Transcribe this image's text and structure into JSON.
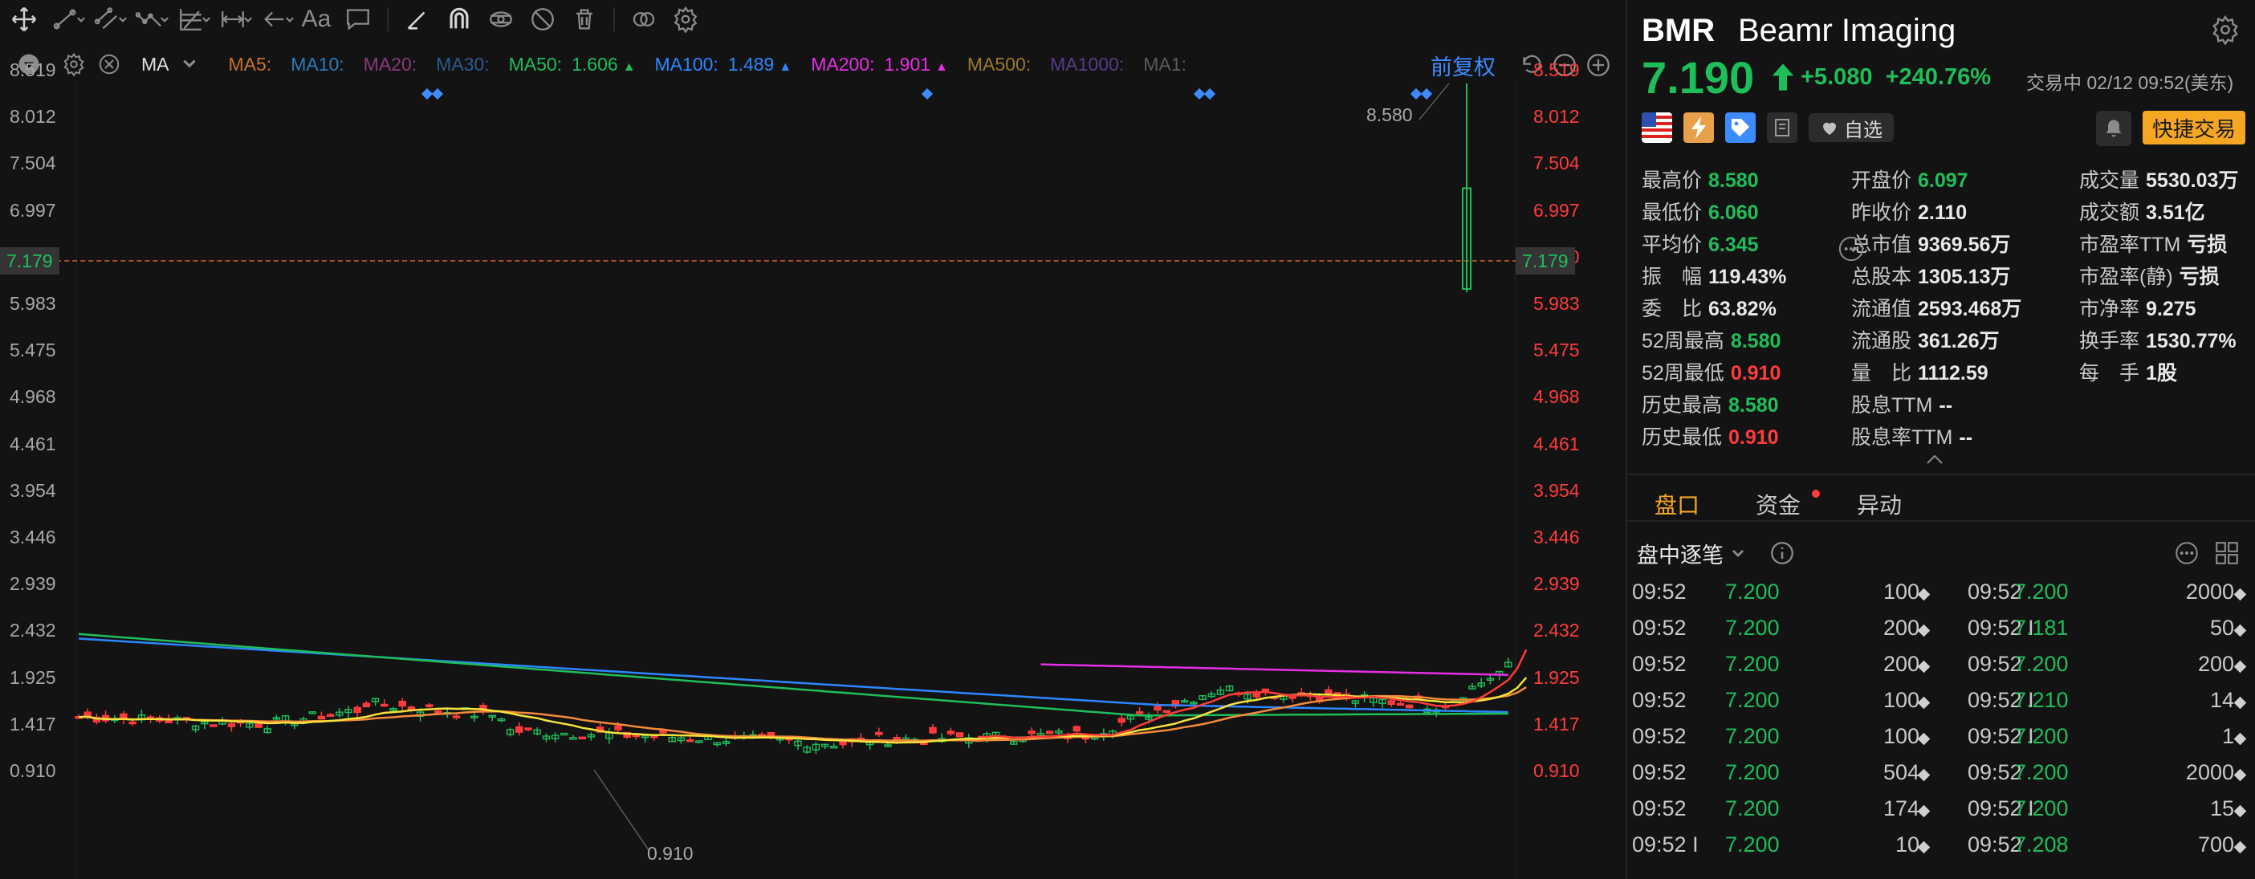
{
  "toolbar": {
    "tools": [
      "move-tool",
      "trendline-tool",
      "channel-tool",
      "polyline-tool",
      "fib-tool",
      "measure-tool",
      "arrow-tool",
      "text-tool",
      "comment-tool",
      "pencil-tool",
      "magnet-tool",
      "hide-tool",
      "eye-off-tool",
      "trash-tool",
      "compare-tool",
      "settings-tool"
    ],
    "text_tool_label": "Aa"
  },
  "ma_bar": {
    "indicator": "MA",
    "items": [
      {
        "label": "MA5:",
        "value": "",
        "color": "#c9722b"
      },
      {
        "label": "MA10:",
        "value": "",
        "color": "#2a7bb8"
      },
      {
        "label": "MA20:",
        "value": "",
        "color": "#8a3b7a"
      },
      {
        "label": "MA30:",
        "value": "",
        "color": "#2c5b8e"
      },
      {
        "label": "MA50:",
        "value": "1.606",
        "arrow": "▲",
        "color": "#1ebe5a"
      },
      {
        "label": "MA100:",
        "value": "1.489",
        "arrow": "▲",
        "color": "#2e86ff"
      },
      {
        "label": "MA200:",
        "value": "1.901",
        "arrow": "▲",
        "color": "#e62ee6"
      },
      {
        "label": "MA500:",
        "value": "",
        "color": "#9a7a2a"
      },
      {
        "label": "MA1000:",
        "value": "",
        "color": "#5a3a8a"
      },
      {
        "label": "MA1:",
        "value": "",
        "color": "#5a5a5a"
      }
    ],
    "adjust_label": "前复权"
  },
  "chart_data": {
    "type": "candlestick",
    "y_ticks": [
      "8.519",
      "8.012",
      "7.504",
      "6.997",
      "6.490",
      "5.983",
      "5.475",
      "4.968",
      "4.461",
      "3.954",
      "3.446",
      "2.939",
      "2.432",
      "1.925",
      "1.417",
      "0.910"
    ],
    "ylim": [
      0.91,
      8.519
    ],
    "current_price_tag": "7.179",
    "high_label": "8.580",
    "low_label": "0.910",
    "last_candle": {
      "open": 6.097,
      "high": 8.58,
      "low": 6.06,
      "close": 7.19
    },
    "ma_lines": {
      "MA50": {
        "color": "#1ebe5a"
      },
      "MA100": {
        "color": "#2e86ff"
      },
      "MA200": {
        "color": "#e62ee6"
      },
      "MA5": {
        "color": "#ff3b3b"
      },
      "MA10": {
        "color": "#f5e23b"
      },
      "MA20": {
        "color": "#f58a3b"
      }
    }
  },
  "quote": {
    "symbol": "BMR",
    "name": "Beamr Imaging",
    "price": "7.190",
    "change": "+5.080",
    "change_pct": "+240.76%",
    "status": "交易中 02/12 09:52(美东)",
    "watch_label": "自选",
    "quick_trade_label": "快捷交易"
  },
  "stats": [
    [
      {
        "k": "最高价",
        "v": "8.580",
        "c": "g"
      },
      {
        "k": "开盘价",
        "v": "6.097",
        "c": "g"
      },
      {
        "k": "成交量",
        "v": "5530.03万",
        "c": "w"
      }
    ],
    [
      {
        "k": "最低价",
        "v": "6.060",
        "c": "g"
      },
      {
        "k": "昨收价",
        "v": "2.110",
        "c": "w"
      },
      {
        "k": "成交额",
        "v": "3.51亿",
        "c": "w"
      }
    ],
    [
      {
        "k": "平均价",
        "v": "6.345",
        "c": "g"
      },
      {
        "k": "总市值",
        "v": "9369.56万",
        "c": "w"
      },
      {
        "k": "市盈率TTM",
        "v": "亏损",
        "c": "w"
      }
    ],
    [
      {
        "k": "振　幅",
        "v": "119.43%",
        "c": "w"
      },
      {
        "k": "总股本",
        "v": "1305.13万",
        "c": "w"
      },
      {
        "k": "市盈率(静)",
        "v": "亏损",
        "c": "w"
      }
    ],
    [
      {
        "k": "委　比",
        "v": "63.82%",
        "c": "w"
      },
      {
        "k": "流通值",
        "v": "2593.468万",
        "c": "w"
      },
      {
        "k": "市净率",
        "v": "9.275",
        "c": "w"
      }
    ],
    [
      {
        "k": "52周最高",
        "v": "8.580",
        "c": "g"
      },
      {
        "k": "流通股",
        "v": "361.26万",
        "c": "w"
      },
      {
        "k": "换手率",
        "v": "1530.77%",
        "c": "w"
      }
    ],
    [
      {
        "k": "52周最低",
        "v": "0.910",
        "c": "r"
      },
      {
        "k": "量　比",
        "v": "1112.59",
        "c": "w"
      },
      {
        "k": "每　手",
        "v": "1股",
        "c": "w"
      }
    ],
    [
      {
        "k": "历史最高",
        "v": "8.580",
        "c": "g"
      },
      {
        "k": "股息TTM",
        "v": "--",
        "c": "w"
      }
    ],
    [
      {
        "k": "历史最低",
        "v": "0.910",
        "c": "r"
      },
      {
        "k": "股息率TTM",
        "v": "--",
        "c": "w"
      }
    ]
  ],
  "tabs": [
    "盘口",
    "资金",
    "异动"
  ],
  "ticks_title": "盘中逐笔",
  "ticks": [
    [
      {
        "t": "09:52",
        "p": "7.200",
        "q": "100"
      },
      {
        "t": "09:52",
        "p": "7.200",
        "q": "2000"
      }
    ],
    [
      {
        "t": "09:52",
        "p": "7.200",
        "q": "200"
      },
      {
        "t": "09:52 I",
        "p": "7.181",
        "q": "50"
      }
    ],
    [
      {
        "t": "09:52",
        "p": "7.200",
        "q": "200"
      },
      {
        "t": "09:52",
        "p": "7.200",
        "q": "200"
      }
    ],
    [
      {
        "t": "09:52",
        "p": "7.200",
        "q": "100"
      },
      {
        "t": "09:52 I",
        "p": "7.210",
        "q": "14"
      }
    ],
    [
      {
        "t": "09:52",
        "p": "7.200",
        "q": "100"
      },
      {
        "t": "09:52 I",
        "p": "7.200",
        "q": "1"
      }
    ],
    [
      {
        "t": "09:52",
        "p": "7.200",
        "q": "504"
      },
      {
        "t": "09:52",
        "p": "7.200",
        "q": "2000"
      }
    ],
    [
      {
        "t": "09:52",
        "p": "7.200",
        "q": "174"
      },
      {
        "t": "09:52 I",
        "p": "7.200",
        "q": "15"
      }
    ],
    [
      {
        "t": "09:52 I",
        "p": "7.200",
        "q": "10"
      },
      {
        "t": "09:52",
        "p": "7.208",
        "q": "700"
      }
    ]
  ]
}
